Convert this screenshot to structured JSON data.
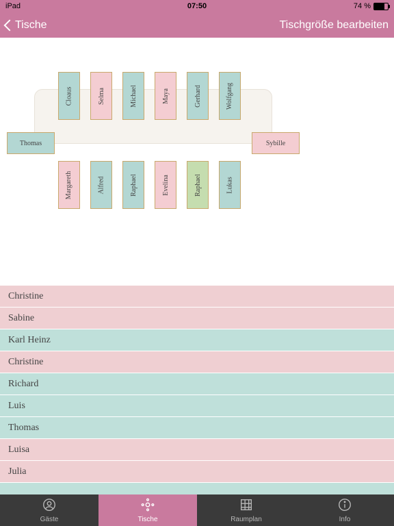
{
  "status": {
    "device": "iPad",
    "time": "07:50",
    "bt": "✱",
    "battery_pct": "74 %"
  },
  "nav": {
    "back": "Tische",
    "action": "Tischgröße bearbeiten"
  },
  "seats": {
    "top": [
      {
        "name": "Cloaus",
        "color": "teal"
      },
      {
        "name": "Selma",
        "color": "pink"
      },
      {
        "name": "Michael",
        "color": "teal"
      },
      {
        "name": "Maya",
        "color": "pink"
      },
      {
        "name": "Gerhard",
        "color": "teal"
      },
      {
        "name": "Wolfgang",
        "color": "teal"
      }
    ],
    "left": {
      "name": "Thomas",
      "color": "teal"
    },
    "right": {
      "name": "Sybille",
      "color": "pink"
    },
    "bottom": [
      {
        "name": "Margareth",
        "color": "pink"
      },
      {
        "name": "Alfred",
        "color": "teal"
      },
      {
        "name": "Raphael",
        "color": "teal"
      },
      {
        "name": "Evelina",
        "color": "pink"
      },
      {
        "name": "Raphael",
        "color": "green"
      },
      {
        "name": "Lukas",
        "color": "teal"
      }
    ]
  },
  "guests": [
    {
      "name": "Christine",
      "color": "pink"
    },
    {
      "name": "Sabine",
      "color": "pink"
    },
    {
      "name": "Karl Heinz",
      "color": "teal"
    },
    {
      "name": "Christine",
      "color": "pink"
    },
    {
      "name": "Richard",
      "color": "teal"
    },
    {
      "name": "Luis",
      "color": "teal"
    },
    {
      "name": "Thomas",
      "color": "teal"
    },
    {
      "name": "Luisa",
      "color": "pink"
    },
    {
      "name": "Julia",
      "color": "pink"
    }
  ],
  "tabs": [
    {
      "id": "gaeste",
      "label": "Gäste"
    },
    {
      "id": "tische",
      "label": "Tische"
    },
    {
      "id": "raumplan",
      "label": "Raumplan"
    },
    {
      "id": "info",
      "label": "Info"
    }
  ],
  "active_tab": "tische"
}
